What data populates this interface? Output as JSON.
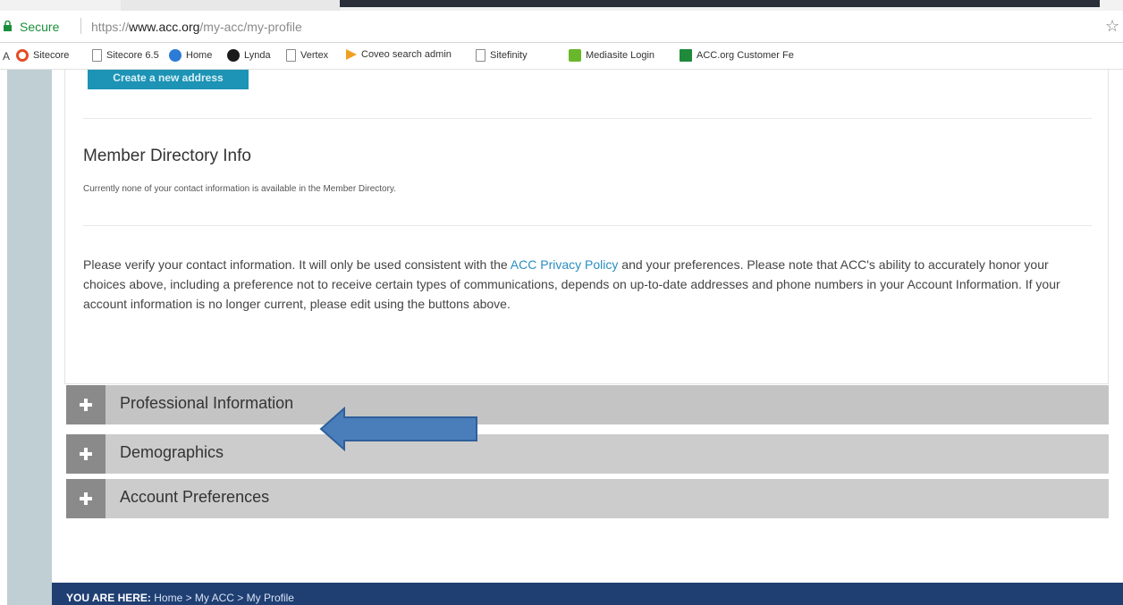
{
  "browser": {
    "secure_label": "Secure",
    "url_scheme": "https://",
    "url_host": "www.acc.org",
    "url_path": "/my-acc/my-profile",
    "bookmarks_lead": "A",
    "bookmarks": [
      {
        "label": "Sitecore",
        "icon": "sitecore-icon"
      },
      {
        "label": "Sitecore 6.5",
        "icon": "page-icon"
      },
      {
        "label": "Home",
        "icon": "home-icon"
      },
      {
        "label": "Lynda",
        "icon": "lynda-icon"
      },
      {
        "label": "Vertex",
        "icon": "page-icon"
      },
      {
        "label": "Coveo search admin",
        "icon": "coveo-icon"
      },
      {
        "label": "Sitefinity",
        "icon": "page-icon"
      },
      {
        "label": "Mediasite Login",
        "icon": "mediasite-icon"
      },
      {
        "label": "ACC.org Customer Fe",
        "icon": "accorg-icon"
      }
    ]
  },
  "profile": {
    "create_address_button": "Create a new address",
    "directory_title": "Member Directory Info",
    "directory_note": "Currently none of your contact information is available in the Member Directory.",
    "verify_part1": "Please verify your contact information. It will only be used consistent with the ",
    "verify_link": "ACC Privacy Policy",
    "verify_part2": " and your preferences. Please note that ACC's ability to accurately honor your choices above, including a preference not to receive certain types of communications, depends on up-to-date addresses and phone numbers in your Account Information. If your account information is no longer current, please edit using the buttons above."
  },
  "accordion": [
    {
      "label": "Professional Information"
    },
    {
      "label": "Demographics"
    },
    {
      "label": "Account Preferences"
    }
  ],
  "footer": {
    "you_are_here": "YOU ARE HERE:",
    "breadcrumb": "Home > My ACC > My Profile"
  },
  "colors": {
    "accent": "#1d93b5",
    "link": "#2a8ec2",
    "footer_bg": "#1f3f73",
    "arrow": "#4a7ebb"
  }
}
